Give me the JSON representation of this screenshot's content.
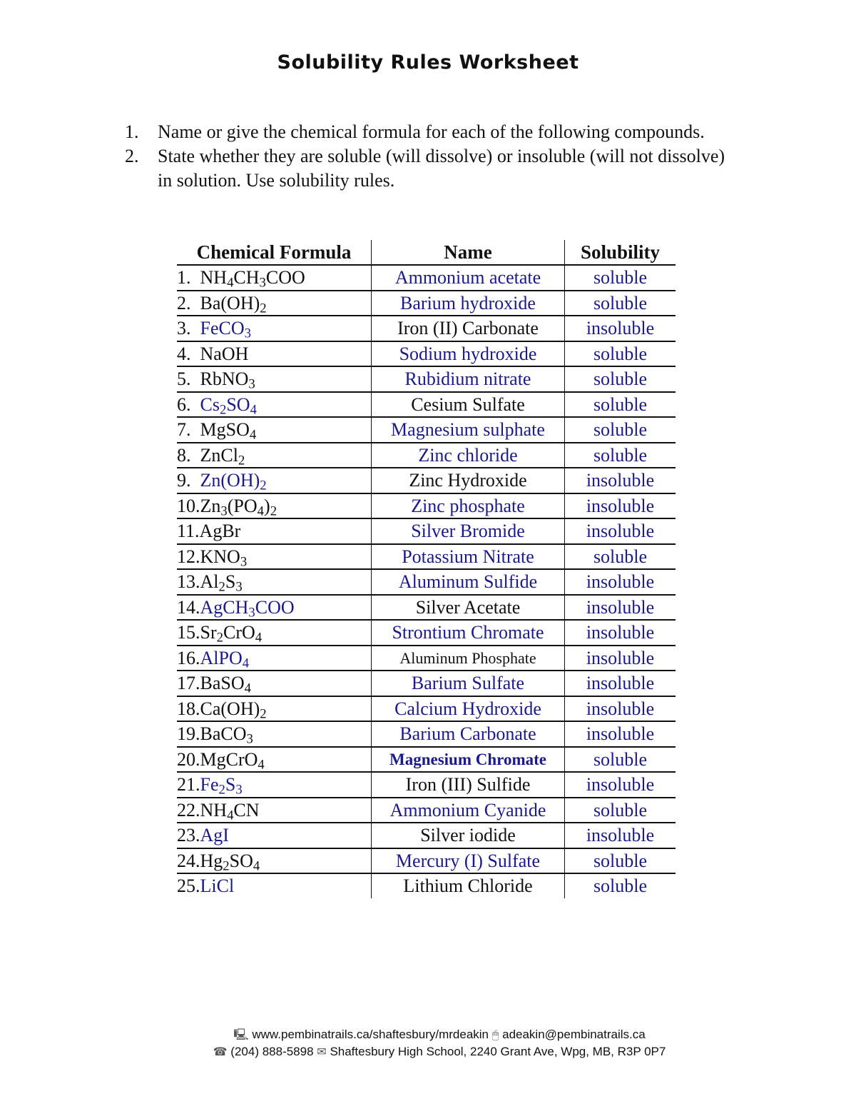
{
  "title": "Solubility Rules Worksheet",
  "instructions": [
    {
      "num": "1.",
      "text": "Name or give the chemical formula for each of the following compounds."
    },
    {
      "num": "2.",
      "text": "State whether they are soluble (will dissolve) or insoluble (will not dissolve) in solution.  Use solubility rules."
    }
  ],
  "table": {
    "headers": [
      "Chemical Formula",
      "Name",
      "Solubility"
    ],
    "rows": [
      {
        "num": "1.  ",
        "formula": [
          [
            "NH",
            ""
          ],
          [
            "4",
            "s"
          ],
          [
            "CH",
            ""
          ],
          [
            "3",
            "s"
          ],
          [
            "COO",
            ""
          ]
        ],
        "formula_answer": false,
        "name": "Ammonium acetate",
        "name_answer": true,
        "solubility": "soluble"
      },
      {
        "num": "2.  ",
        "formula": [
          [
            "Ba(OH)",
            ""
          ],
          [
            "2",
            "s"
          ]
        ],
        "formula_answer": false,
        "name": "Barium hydroxide",
        "name_answer": true,
        "solubility": "soluble"
      },
      {
        "num": "3.  ",
        "formula": [
          [
            "FeCO",
            ""
          ],
          [
            "3",
            "s"
          ]
        ],
        "formula_answer": true,
        "name": "Iron (II) Carbonate",
        "name_answer": false,
        "solubility": "insoluble"
      },
      {
        "num": "4.  ",
        "formula": [
          [
            "NaOH",
            ""
          ]
        ],
        "formula_answer": false,
        "name": "Sodium hydroxide",
        "name_answer": true,
        "solubility": "soluble"
      },
      {
        "num": "5.  ",
        "formula": [
          [
            "RbNO",
            ""
          ],
          [
            "3",
            "s"
          ]
        ],
        "formula_answer": false,
        "name": "Rubidium nitrate",
        "name_answer": true,
        "solubility": "soluble"
      },
      {
        "num": "6.  ",
        "formula": [
          [
            "Cs",
            ""
          ],
          [
            "2",
            "s"
          ],
          [
            "SO",
            ""
          ],
          [
            "4",
            "s"
          ]
        ],
        "formula_answer": true,
        "name": "Cesium Sulfate",
        "name_answer": false,
        "solubility": "soluble"
      },
      {
        "num": "7.  ",
        "formula": [
          [
            "MgSO",
            ""
          ],
          [
            "4",
            "s"
          ]
        ],
        "formula_answer": false,
        "name": "Magnesium sulphate",
        "name_answer": true,
        "solubility": "soluble"
      },
      {
        "num": "8.  ",
        "formula": [
          [
            "ZnCl",
            ""
          ],
          [
            "2",
            "s"
          ]
        ],
        "formula_answer": false,
        "name": "Zinc chloride",
        "name_answer": true,
        "solubility": "soluble"
      },
      {
        "num": "9.  ",
        "formula": [
          [
            "Zn(OH)",
            ""
          ],
          [
            "2",
            "s"
          ]
        ],
        "formula_answer": true,
        "name": "Zinc Hydroxide",
        "name_answer": false,
        "solubility": "insoluble"
      },
      {
        "num": "10.",
        "formula": [
          [
            "Zn",
            ""
          ],
          [
            "3",
            "s"
          ],
          [
            "(PO",
            ""
          ],
          [
            "4",
            "s"
          ],
          [
            ")",
            ""
          ],
          [
            "2",
            "s"
          ]
        ],
        "formula_answer": false,
        "name": "Zinc phosphate",
        "name_answer": true,
        "solubility": "insoluble"
      },
      {
        "num": "11.",
        "formula": [
          [
            "AgBr",
            ""
          ]
        ],
        "formula_answer": false,
        "name": "Silver Bromide",
        "name_answer": true,
        "solubility": "insoluble"
      },
      {
        "num": "12.",
        "formula": [
          [
            "KNO",
            ""
          ],
          [
            "3",
            "s"
          ]
        ],
        "formula_answer": false,
        "name": "Potassium Nitrate",
        "name_answer": true,
        "solubility": "soluble"
      },
      {
        "num": "13.",
        "formula": [
          [
            "Al",
            ""
          ],
          [
            "2",
            "s"
          ],
          [
            "S",
            ""
          ],
          [
            "3",
            "s"
          ]
        ],
        "formula_answer": false,
        "name": "Aluminum Sulfide",
        "name_answer": true,
        "solubility": "insoluble"
      },
      {
        "num": "14.",
        "formula": [
          [
            "AgCH",
            ""
          ],
          [
            "3",
            "s"
          ],
          [
            "COO",
            ""
          ]
        ],
        "formula_answer": true,
        "name": "Silver Acetate",
        "name_answer": false,
        "solubility": "insoluble"
      },
      {
        "num": "15.",
        "formula": [
          [
            "Sr",
            ""
          ],
          [
            "2",
            "s"
          ],
          [
            "CrO",
            ""
          ],
          [
            "4",
            "s"
          ]
        ],
        "formula_answer": false,
        "name": "Strontium Chromate",
        "name_answer": true,
        "solubility": "insoluble"
      },
      {
        "num": "16.",
        "formula": [
          [
            "AlPO",
            ""
          ],
          [
            "4",
            "s"
          ]
        ],
        "formula_answer": true,
        "name": "Aluminum Phosphate",
        "name_answer": false,
        "name_style": "small",
        "solubility": "insoluble"
      },
      {
        "num": "17.",
        "formula": [
          [
            "BaSO",
            ""
          ],
          [
            "4",
            "s"
          ]
        ],
        "formula_answer": false,
        "name": "Barium Sulfate",
        "name_answer": true,
        "solubility": "insoluble"
      },
      {
        "num": "18.",
        "formula": [
          [
            "Ca(OH)",
            ""
          ],
          [
            "2",
            "s"
          ]
        ],
        "formula_answer": false,
        "name": "Calcium Hydroxide",
        "name_answer": true,
        "solubility": "insoluble"
      },
      {
        "num": "19.",
        "formula": [
          [
            "BaCO",
            ""
          ],
          [
            "3",
            "s"
          ]
        ],
        "formula_answer": false,
        "name": "Barium Carbonate",
        "name_answer": true,
        "solubility": "insoluble"
      },
      {
        "num": "20.",
        "formula": [
          [
            "MgCrO",
            ""
          ],
          [
            "4",
            "s"
          ]
        ],
        "formula_answer": false,
        "name": "Magnesium Chromate",
        "name_answer": true,
        "name_style": "bold",
        "solubility": "soluble"
      },
      {
        "num": "21.",
        "formula": [
          [
            "Fe",
            ""
          ],
          [
            "2",
            "s"
          ],
          [
            "S",
            ""
          ],
          [
            "3",
            "s"
          ]
        ],
        "formula_answer": true,
        "name": "Iron (III) Sulfide",
        "name_answer": false,
        "solubility": "insoluble"
      },
      {
        "num": "22.",
        "formula": [
          [
            "NH",
            ""
          ],
          [
            "4",
            "s"
          ],
          [
            "CN",
            ""
          ]
        ],
        "formula_answer": false,
        "name": "Ammonium Cyanide",
        "name_answer": true,
        "solubility": "soluble"
      },
      {
        "num": "23.",
        "formula": [
          [
            "AgI",
            ""
          ]
        ],
        "formula_answer": true,
        "name": "Silver iodide",
        "name_answer": false,
        "solubility": "insoluble"
      },
      {
        "num": "24.",
        "formula": [
          [
            "Hg",
            ""
          ],
          [
            "2",
            "s"
          ],
          [
            "SO",
            ""
          ],
          [
            "4",
            "s"
          ]
        ],
        "formula_answer": false,
        "name": "Mercury (I) Sulfate",
        "name_answer": true,
        "solubility": "soluble"
      },
      {
        "num": "25.",
        "formula": [
          [
            "LiCl",
            ""
          ]
        ],
        "formula_answer": true,
        "name": "Lithium Chloride",
        "name_answer": false,
        "solubility": "soluble"
      }
    ]
  },
  "footer": {
    "website_icon": "computer-icon",
    "website": "www.pembinatrails.ca/shaftesbury/mrdeakin",
    "email_icon": "mouse-icon",
    "email": "adeakin@pembinatrails.ca",
    "phone_icon": "telephone-icon",
    "phone": "(204) 888-5898",
    "address_icon": "envelope-icon",
    "address": "Shaftesbury High School, 2240 Grant Ave, Wpg, MB, R3P 0P7"
  },
  "colors": {
    "answer": "#1a1a8c",
    "text": "#111111"
  }
}
